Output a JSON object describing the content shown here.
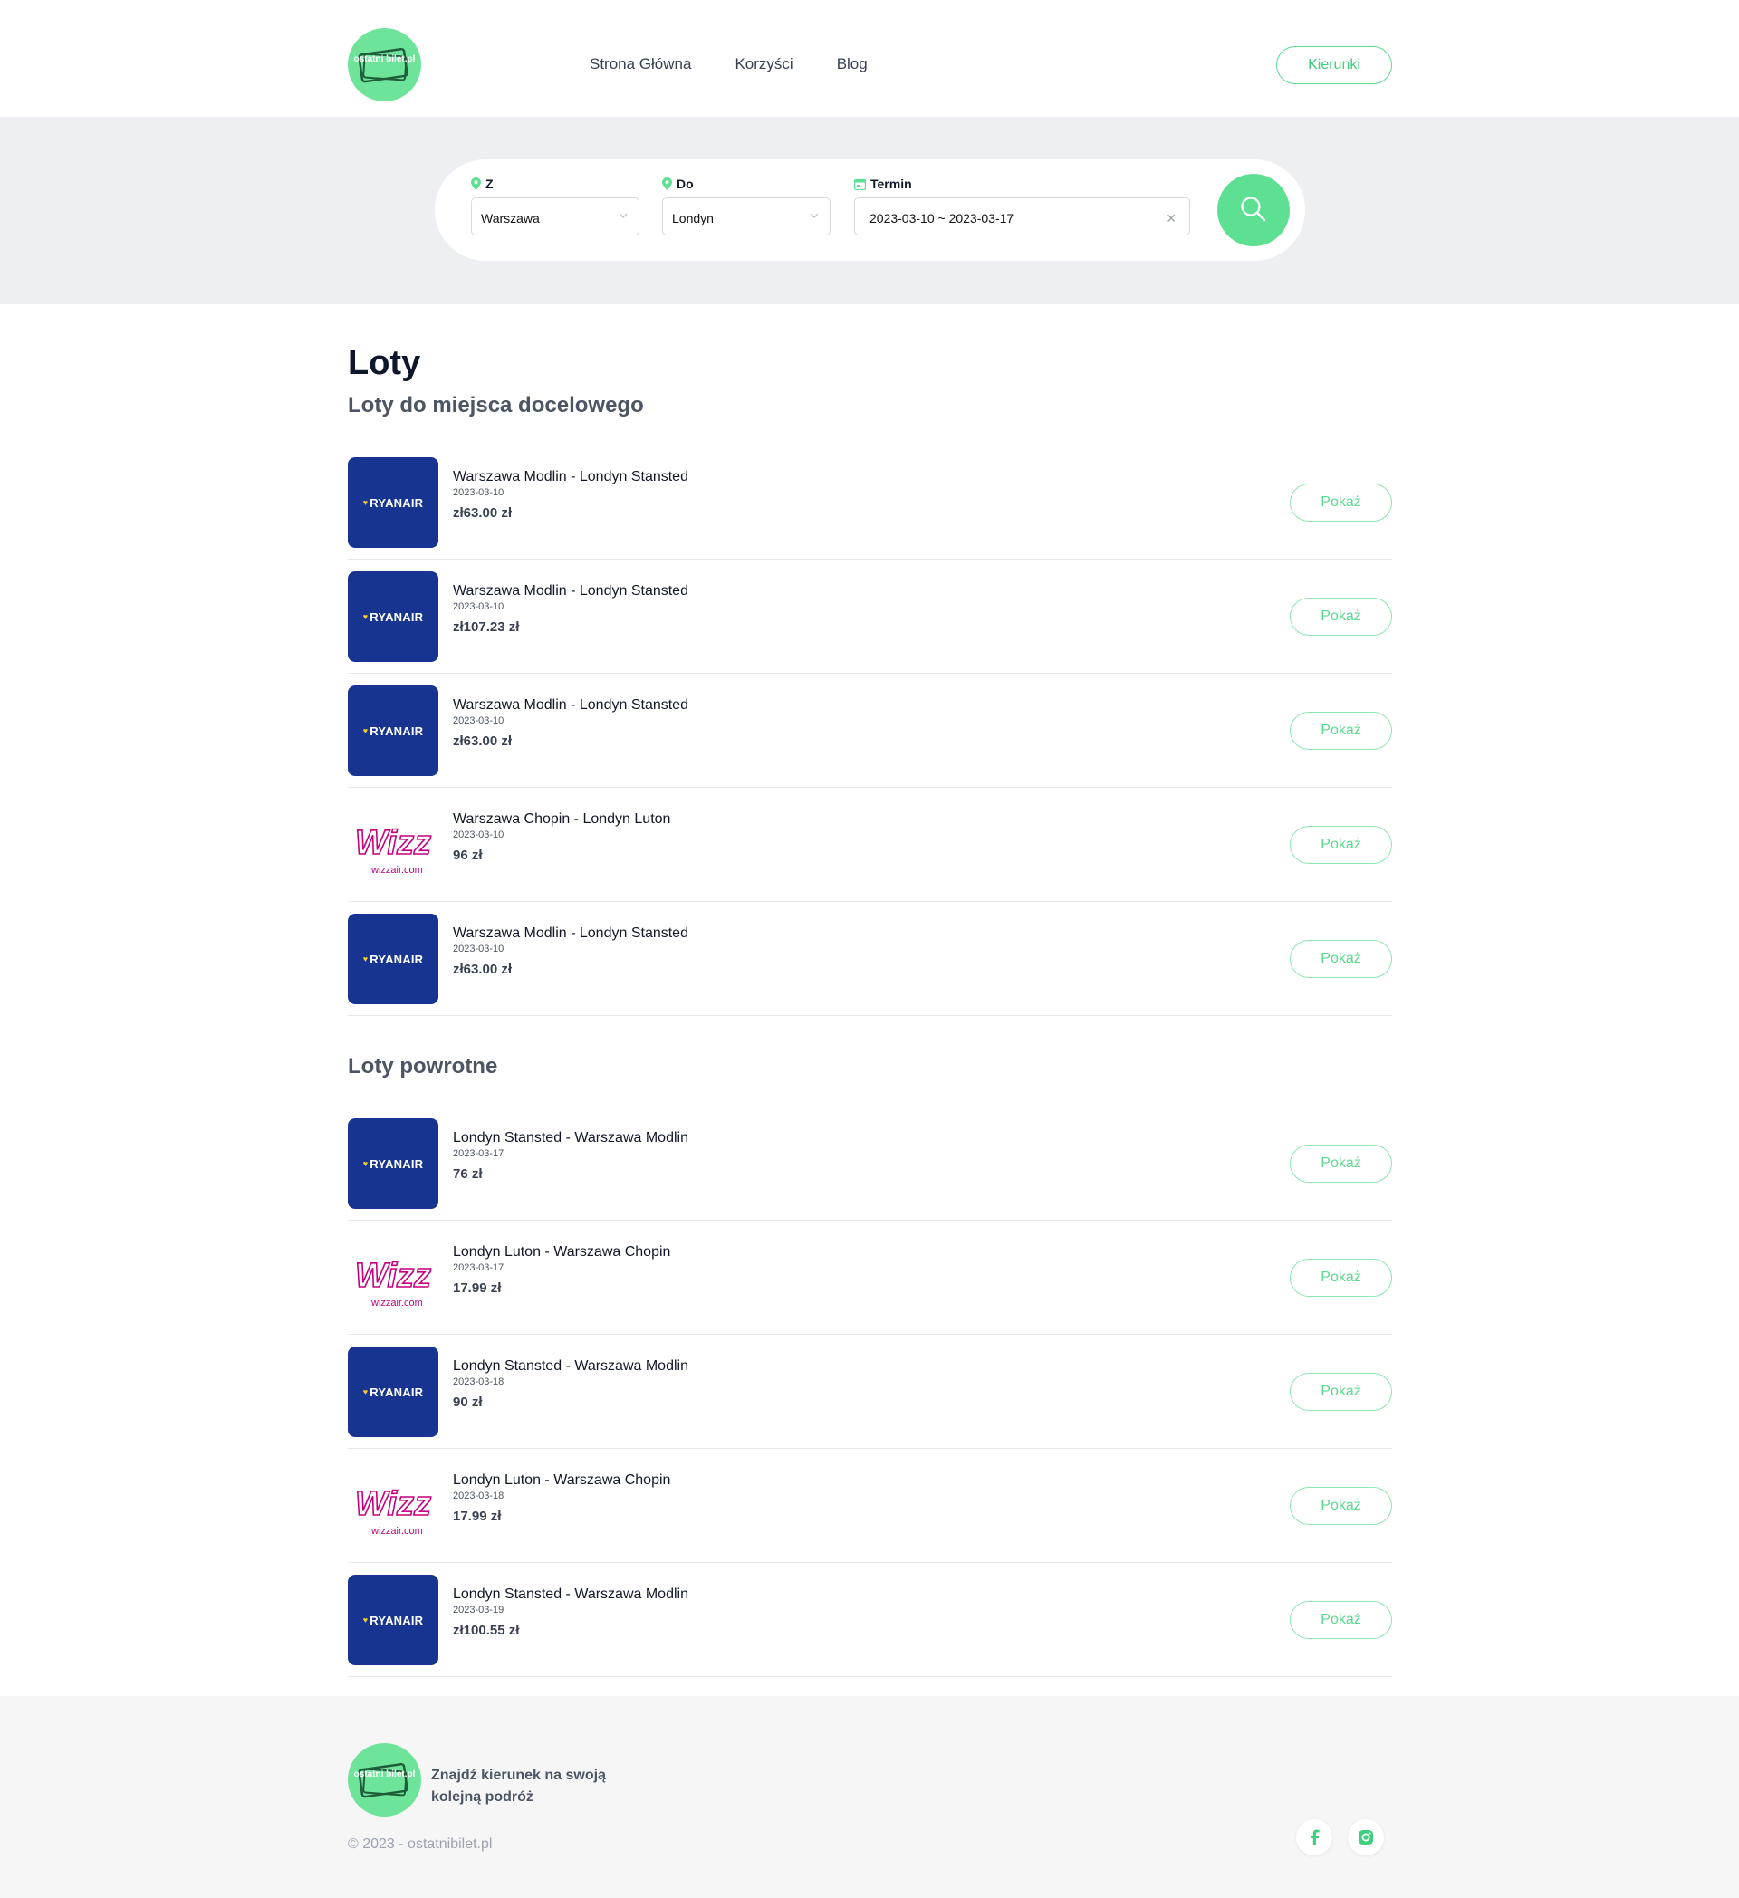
{
  "header": {
    "logo_text": "ostatni bilet.pl",
    "nav": [
      "Strona Główna",
      "Korzyści",
      "Blog"
    ],
    "cta_label": "Kierunki"
  },
  "search": {
    "from": {
      "label": "Z",
      "value": "Warszawa"
    },
    "to": {
      "label": "Do",
      "value": "Londyn"
    },
    "date": {
      "label": "Termin",
      "value": "2023-03-10 ~ 2023-03-17"
    }
  },
  "main": {
    "title": "Loty",
    "outbound_title": "Loty do miejsca docelowego",
    "return_title": "Loty powrotne",
    "button_label": "Pokaż",
    "outbound": [
      {
        "airline": "ryanair",
        "logo_text": "RYANAIR",
        "route": "Warszawa Modlin - Londyn Stansted",
        "date": "2023-03-10",
        "price": "zł63.00 zł"
      },
      {
        "airline": "ryanair",
        "logo_text": "RYANAIR",
        "route": "Warszawa Modlin - Londyn Stansted",
        "date": "2023-03-10",
        "price": "zł107.23 zł"
      },
      {
        "airline": "ryanair",
        "logo_text": "RYANAIR",
        "route": "Warszawa Modlin - Londyn Stansted",
        "date": "2023-03-10",
        "price": "zł63.00 zł"
      },
      {
        "airline": "wizz",
        "logo_text": "wizzair.com",
        "route": "Warszawa Chopin - Londyn Luton",
        "date": "2023-03-10",
        "price": "96 zł"
      },
      {
        "airline": "ryanair",
        "logo_text": "RYANAIR",
        "route": "Warszawa Modlin - Londyn Stansted",
        "date": "2023-03-10",
        "price": "zł63.00 zł"
      }
    ],
    "return": [
      {
        "airline": "ryanair",
        "logo_text": "RYANAIR",
        "route": "Londyn Stansted - Warszawa Modlin",
        "date": "2023-03-17",
        "price": "76 zł"
      },
      {
        "airline": "wizz",
        "logo_text": "wizzair.com",
        "route": "Londyn Luton - Warszawa Chopin",
        "date": "2023-03-17",
        "price": "17.99 zł"
      },
      {
        "airline": "ryanair",
        "logo_text": "RYANAIR",
        "route": "Londyn Stansted - Warszawa Modlin",
        "date": "2023-03-18",
        "price": "90 zł"
      },
      {
        "airline": "wizz",
        "logo_text": "wizzair.com",
        "route": "Londyn Luton - Warszawa Chopin",
        "date": "2023-03-18",
        "price": "17.99 zł"
      },
      {
        "airline": "ryanair",
        "logo_text": "RYANAIR",
        "route": "Londyn Stansted - Warszawa Modlin",
        "date": "2023-03-19",
        "price": "zł100.55 zł"
      }
    ]
  },
  "footer": {
    "tagline": "Znajdź kierunek na swoją kolejną podróż",
    "copyright": "© 2023 - ostatnibilet.pl",
    "social": [
      "facebook-icon",
      "instagram-icon"
    ]
  },
  "colors": {
    "accent": "#5ee093",
    "ryanair_blue": "#173590",
    "band_bg": "#eeeff2"
  }
}
